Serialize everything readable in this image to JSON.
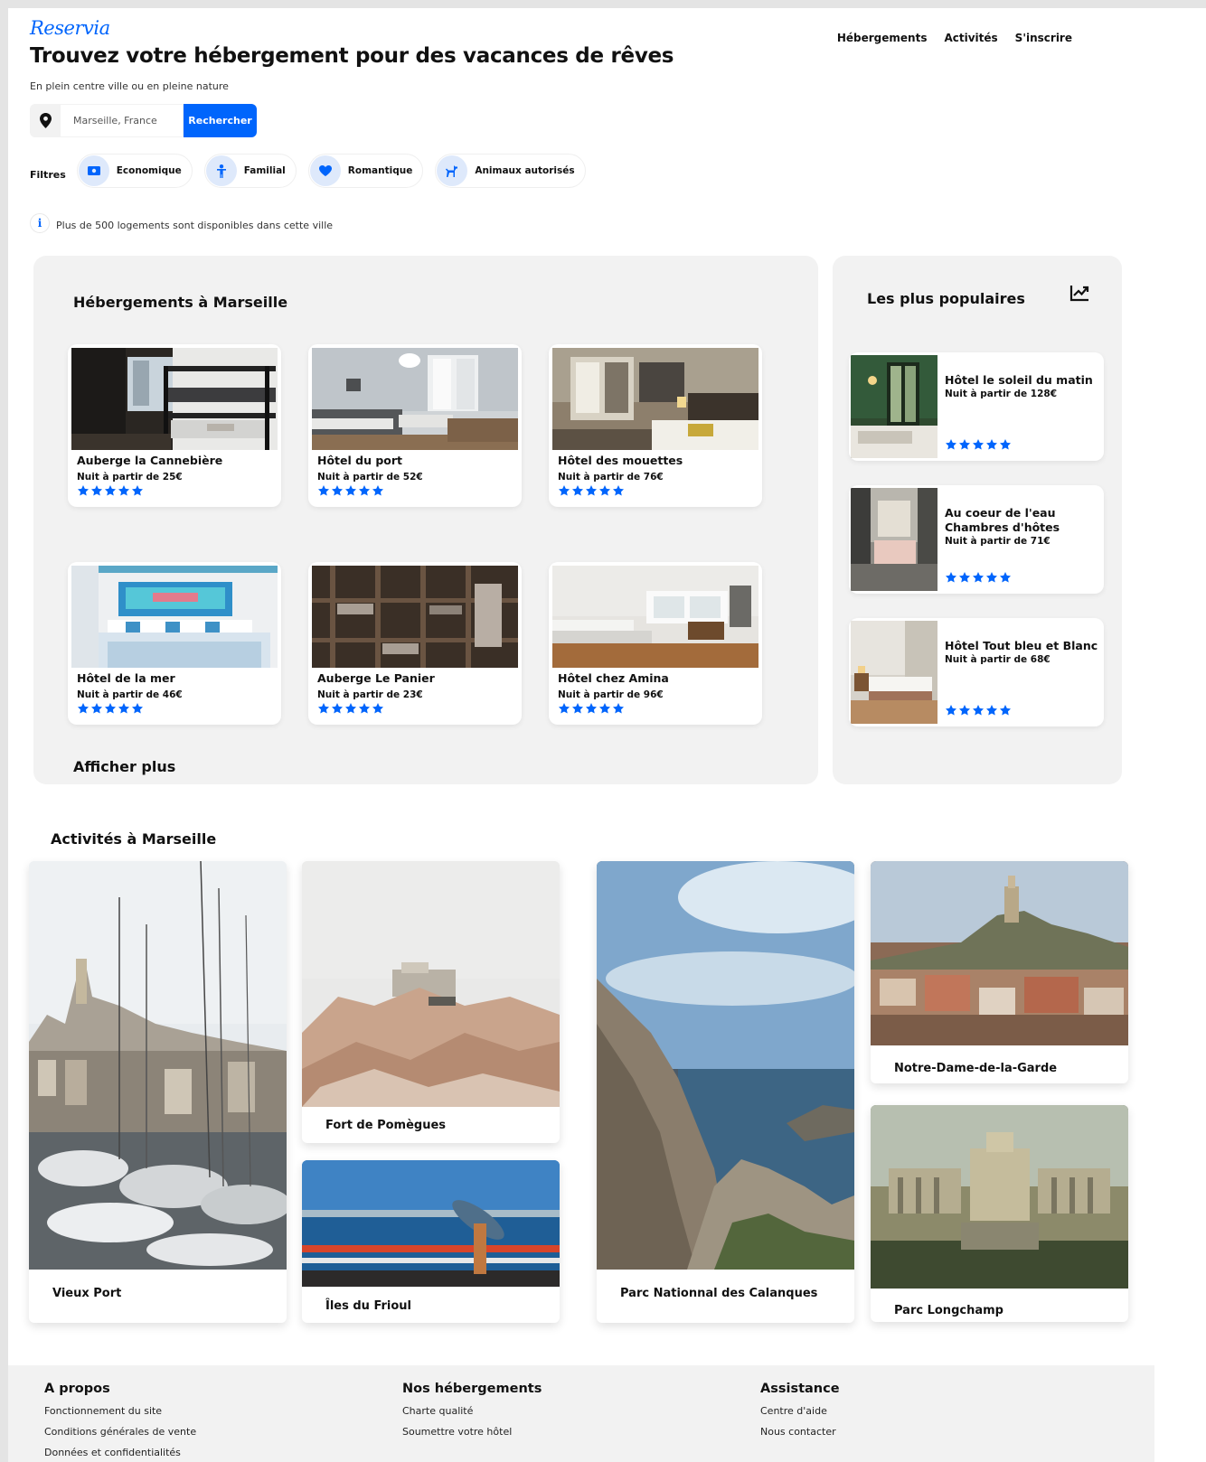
{
  "brand": {
    "logo": "Reservia",
    "accent": "#0065fc"
  },
  "nav": {
    "hebergements": "Hébergements",
    "activites": "Activités",
    "inscrire": "S'inscrire"
  },
  "hero": {
    "title": "Trouvez votre hébergement pour des vacances de rêves",
    "subtitle": "En plein centre ville ou en pleine nature"
  },
  "search": {
    "value": "Marseille, France",
    "button": "Rechercher"
  },
  "filters": {
    "label": "Filtres",
    "items": [
      {
        "label": "Economique",
        "icon": "money-icon"
      },
      {
        "label": "Familial",
        "icon": "person-icon"
      },
      {
        "label": "Romantique",
        "icon": "heart-icon"
      },
      {
        "label": "Animaux autorisés",
        "icon": "dog-icon"
      }
    ]
  },
  "info": {
    "text": "Plus de 500 logements sont disponibles dans cette ville"
  },
  "hosting": {
    "title": "Hébergements à Marseille",
    "more": "Afficher plus",
    "cards": [
      {
        "name": "Auberge la Cannebière",
        "price": "Nuit à partir de 25€",
        "rating": 5
      },
      {
        "name": "Hôtel du port",
        "price": "Nuit à partir de 52€",
        "rating": 5
      },
      {
        "name": "Hôtel des mouettes",
        "price": "Nuit à partir de 76€",
        "rating": 5
      },
      {
        "name": "Hôtel de la mer",
        "price": "Nuit à partir de 46€",
        "rating": 5
      },
      {
        "name": "Auberge Le Panier",
        "price": "Nuit à partir de 23€",
        "rating": 5
      },
      {
        "name": "Hôtel chez Amina",
        "price": "Nuit à partir de 96€",
        "rating": 5
      }
    ]
  },
  "popular": {
    "title": "Les plus populaires",
    "cards": [
      {
        "name": "Hôtel le soleil du matin",
        "price": "Nuit à partir de 128€",
        "rating": 5
      },
      {
        "name": "Au coeur de l'eau Chambres d'hôtes",
        "price": "Nuit à partir de 71€",
        "rating": 5
      },
      {
        "name": "Hôtel Tout bleu et Blanc",
        "price": "Nuit à partir de 68€",
        "rating": 5
      }
    ]
  },
  "activities": {
    "title": "Activités à Marseille",
    "items": [
      "Vieux Port",
      "Fort de Pomègues",
      "Îles du Frioul",
      "Parc Nationnal des Calanques",
      "Notre-Dame-de-la-Garde",
      "Parc Longchamp"
    ]
  },
  "footer": {
    "col1": {
      "title": "A propos",
      "links": [
        "Fonctionnement du site",
        "Conditions générales de vente",
        "Données et confidentialités"
      ]
    },
    "col2": {
      "title": "Nos hébergements",
      "links": [
        "Charte qualité",
        "Soumettre votre hôtel"
      ]
    },
    "col3": {
      "title": "Assistance",
      "links": [
        "Centre d'aide",
        "Nous contacter"
      ]
    }
  }
}
